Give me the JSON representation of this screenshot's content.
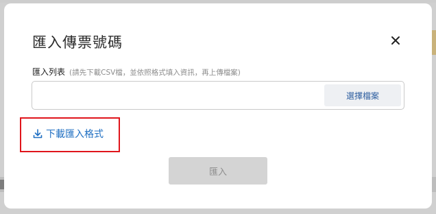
{
  "modal": {
    "title": "匯入傳票號碼",
    "close_icon": "close-icon",
    "field": {
      "label": "匯入列表",
      "hint": "(請先下載CSV檔，並依照格式填入資訊，再上傳檔案)",
      "file_value": "",
      "choose_button_label": "選擇檔案"
    },
    "download": {
      "icon": "download-icon",
      "label": "下載匯入格式"
    },
    "submit": {
      "label": "匯入",
      "disabled": true
    }
  },
  "colors": {
    "link": "#1f6fc2",
    "highlight": "#e0141b",
    "choose_button_bg": "#eef0f3",
    "disabled_button_bg": "#d4d4d4",
    "overlay": "#d0d0d0"
  }
}
